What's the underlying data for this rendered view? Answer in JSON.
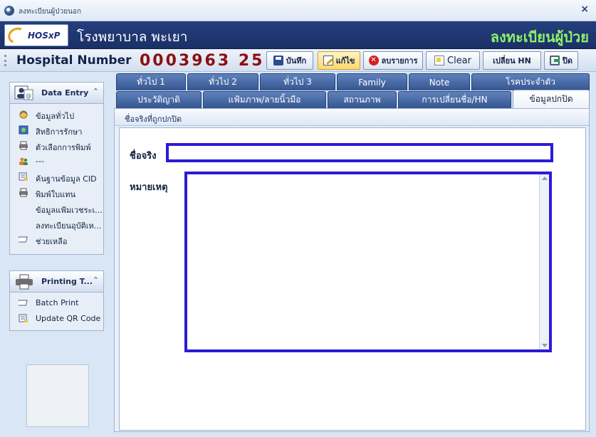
{
  "window": {
    "title": "ลงทะเบียนผู้ป่วยนอก"
  },
  "banner": {
    "logo_text": "HOSxP",
    "hospital_name": "โรงพยาบาล พะเยา",
    "form_title": "ลงทะเบียนผู้ป่วย"
  },
  "toolbar": {
    "hn_label": "Hospital Number",
    "hn_value": "0003963 25",
    "buttons": {
      "save": "บันทึก",
      "edit": "แก้ไข",
      "delete": "ลบรายการ",
      "clear": "Clear",
      "change_hn": "เปลี่ยน HN",
      "close": "ปิด"
    }
  },
  "nav": {
    "data_entry": {
      "title": "Data Entry",
      "items": [
        "ข้อมูลทั่วไป",
        "สิทธิการรักษา",
        "ตัวเลือกการพิมพ์",
        "---",
        "ค้นฐานข้อมูล CID",
        "พิมพ์ใบแทน",
        "ข้อมูลแฟ้มเวชระเ...",
        "ลงทะเบียนอุบัติเห...",
        "ช่วยเหลือ"
      ]
    },
    "printing": {
      "title": "Printing T...",
      "items": [
        "Batch Print",
        "Update QR Code"
      ]
    }
  },
  "tabs": {
    "row1": [
      "ทั่วไป 1",
      "ทั่วไป 2",
      "ทั่วไป 3",
      "Family",
      "Note",
      "โรคประจำตัว"
    ],
    "row2": [
      "ประวัติญาติ",
      "แฟ้มภาพ/ลายนิ้วมือ",
      "สถานภาพ",
      "การเปลี่ยนชื่อ/HN",
      "ข้อมูลปกปิด"
    ]
  },
  "content": {
    "section_title": "ชื่อจริงที่ถูกปกปิด",
    "real_name_label": "ชื่อจริง",
    "real_name_value": "",
    "remark_label": "หมายเหตุ",
    "remark_value": ""
  },
  "colors": {
    "banner_bg": "#1a3066",
    "form_title": "#8ef06a",
    "hn_value": "#8c1010",
    "field_border": "#2d1bd8"
  }
}
